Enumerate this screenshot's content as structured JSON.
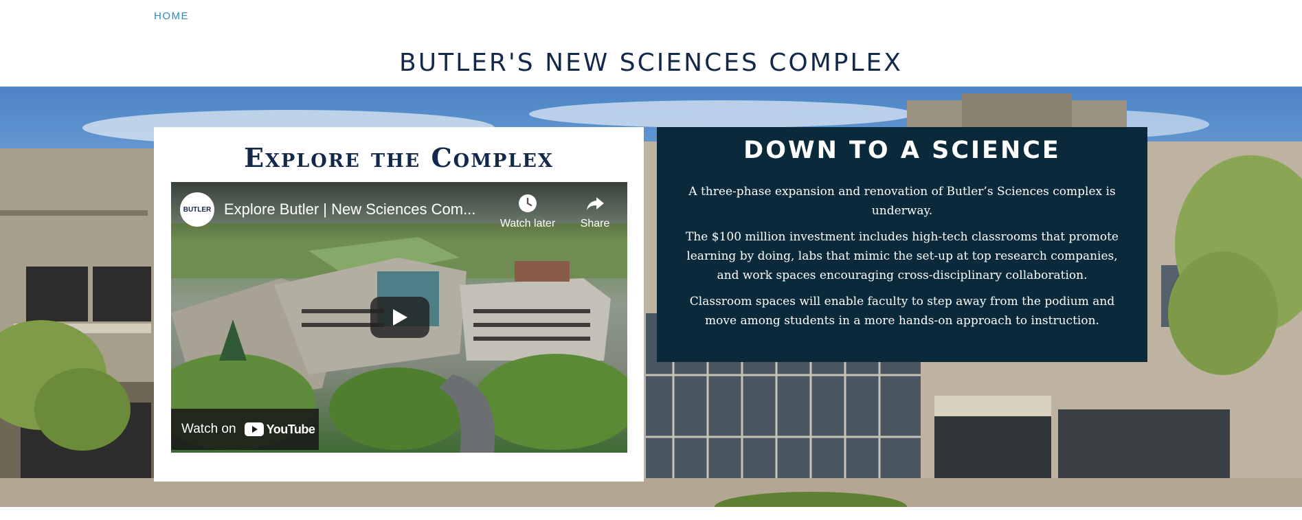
{
  "nav": {
    "home_label": "HOME"
  },
  "page": {
    "title": "BUTLER'S NEW SCIENCES COMPLEX"
  },
  "video_card": {
    "heading": "Explore the Complex",
    "player": {
      "channel_logo_text": "BUTLER",
      "video_title": "Explore Butler | New Sciences Com...",
      "watch_later_label": "Watch later",
      "share_label": "Share",
      "watch_on_label": "Watch on",
      "youtube_label": "YouTube"
    }
  },
  "info_card": {
    "heading": "DOWN TO A SCIENCE",
    "paragraphs": [
      "A three-phase expansion and renovation of Butler’s Sciences complex is underway.",
      "The $100 million investment includes high-tech classrooms that promote learning by doing, labs that mimic the set-up at top research companies, and work spaces encouraging cross-disciplinary collaboration.",
      "Classroom spaces will enable faculty to step away from the podium and move among students in a more hands-on approach to instruction."
    ]
  },
  "colors": {
    "navy": "#13294b",
    "link_blue": "#2b8cc4",
    "info_card_bg": "#0a2a3b",
    "youtube_red": "#ff0000"
  }
}
